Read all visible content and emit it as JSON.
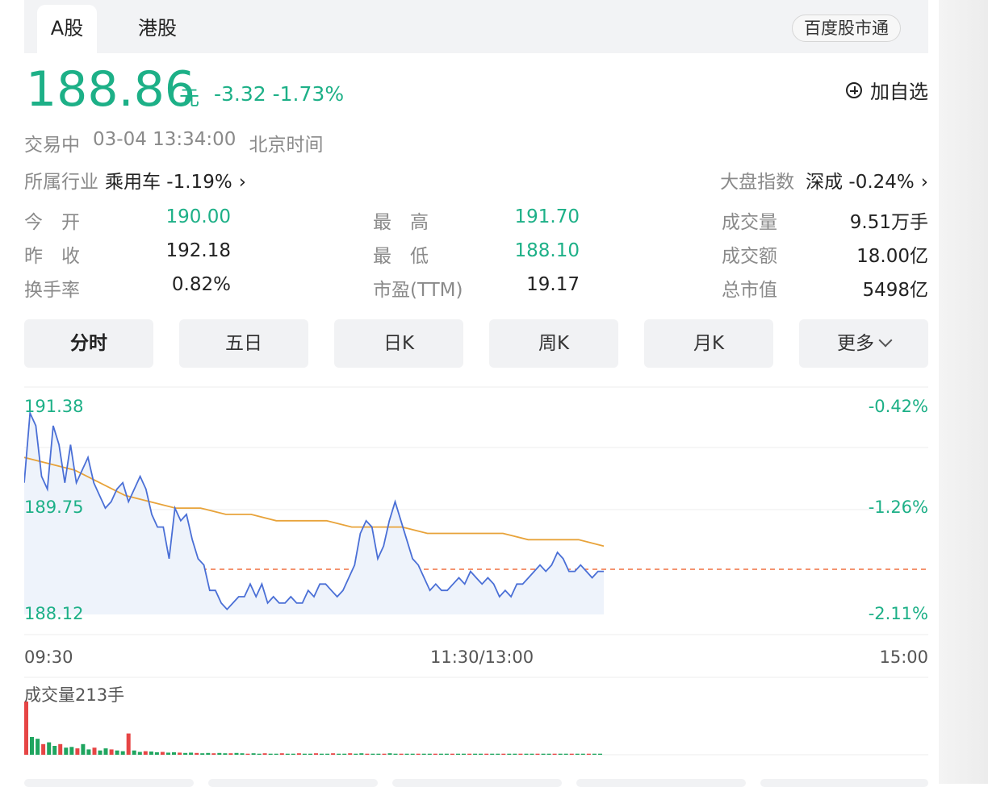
{
  "tabs": [
    {
      "label": "A股",
      "active": true
    },
    {
      "label": "港股",
      "active": false
    }
  ],
  "service_button": "百度股市通",
  "quote": {
    "price": "188.86",
    "unit": "元",
    "change": "-3.32 -1.73%",
    "add_watch": "加自选",
    "status": "交易中",
    "time": "03-04 13:34:00",
    "timezone": "北京时间",
    "industry_label": "所属行业",
    "industry_value": "乘用车 -1.19%",
    "index_label": "大盘指数",
    "index_value": "深成 -0.24%"
  },
  "stats": {
    "open_label": "今　开",
    "open": "190.00",
    "high_label": "最　高",
    "high": "191.70",
    "volume_label": "成交量",
    "volume": "9.51万手",
    "prev_label": "昨　收",
    "prev": "192.18",
    "low_label": "最　低",
    "low": "188.10",
    "amount_label": "成交额",
    "amount": "18.00亿",
    "turnover_label": "换手率",
    "turnover": "0.82%",
    "pe_label": "市盈(TTM)",
    "pe": "19.17",
    "mcap_label": "总市值",
    "mcap": "5498亿"
  },
  "periods": [
    "分时",
    "五日",
    "日K",
    "周K",
    "月K",
    "更多"
  ],
  "chart": {
    "price_high": "191.38",
    "price_mid": "189.75",
    "price_low": "188.12",
    "pct_high": "-0.42%",
    "pct_mid": "-1.26%",
    "pct_low": "-2.11%",
    "time_start": "09:30",
    "time_mid": "11:30/13:00",
    "time_end": "15:00",
    "volume_label": "成交量213手"
  },
  "chart_data": {
    "type": "line",
    "ylim": [
      188.12,
      191.38
    ],
    "prev_close": 192.18,
    "x_range": [
      "09:30",
      "15:00"
    ],
    "series": [
      {
        "values": [
          190.2,
          191.3,
          191.1,
          190.3,
          190.1,
          191.1,
          190.8,
          190.2,
          190.8,
          190.2,
          190.4,
          190.6,
          190.2,
          190.0,
          189.8,
          189.9,
          190.1,
          190.2,
          189.9,
          190.1,
          190.3,
          190.1,
          189.7,
          189.5,
          189.5,
          189.0,
          189.8,
          189.6,
          189.7,
          189.3,
          189.0,
          188.9,
          188.5,
          188.5,
          188.3,
          188.2,
          188.3,
          188.4,
          188.4,
          188.6,
          188.4,
          188.6,
          188.3,
          188.4,
          188.3,
          188.3,
          188.4,
          188.3,
          188.3,
          188.5,
          188.4,
          188.6,
          188.6,
          188.5,
          188.4,
          188.5,
          188.7,
          188.9,
          189.4,
          189.6,
          189.5,
          189.0,
          189.2,
          189.6,
          189.9,
          189.6,
          189.3,
          189.0,
          188.9,
          188.7,
          188.5,
          188.6,
          188.5,
          188.5,
          188.6,
          188.7,
          188.6,
          188.8,
          188.7,
          188.6,
          188.7,
          188.6,
          188.4,
          188.5,
          188.4,
          188.6,
          188.6,
          188.7,
          188.8,
          188.9,
          188.8,
          188.9,
          189.1,
          189.0,
          188.8,
          188.8,
          188.9,
          188.8,
          188.7,
          188.8,
          188.8
        ]
      },
      {
        "values": [
          190.6,
          190.5,
          190.4,
          190.2,
          190.0,
          189.9,
          189.8,
          189.8,
          189.7,
          189.7,
          189.6,
          189.6,
          189.6,
          189.5,
          189.5,
          189.5,
          189.4,
          189.4,
          189.4,
          189.4,
          189.3,
          189.3,
          189.3,
          189.2
        ]
      }
    ],
    "volumes": [
      150,
      50,
      45,
      30,
      35,
      25,
      30,
      20,
      22,
      18,
      30,
      15,
      20,
      12,
      18,
      15,
      12,
      10,
      60,
      12,
      8,
      10,
      9,
      7,
      8,
      6,
      7,
      6,
      5,
      6,
      5,
      4,
      5,
      4,
      5,
      4,
      4,
      5,
      4,
      3,
      4,
      3,
      4,
      3,
      3,
      4,
      3,
      3,
      4,
      3,
      3,
      4,
      3,
      3,
      4,
      3,
      3,
      4,
      3,
      4,
      3,
      3,
      3,
      3,
      4,
      3,
      3,
      3,
      3,
      3,
      3,
      3,
      3,
      3,
      3,
      3,
      3,
      3,
      3,
      3,
      3,
      3,
      3,
      3,
      3,
      3,
      3,
      3,
      3,
      3,
      3,
      3,
      3,
      3,
      3,
      3,
      3,
      3,
      3,
      3,
      3,
      3
    ]
  }
}
